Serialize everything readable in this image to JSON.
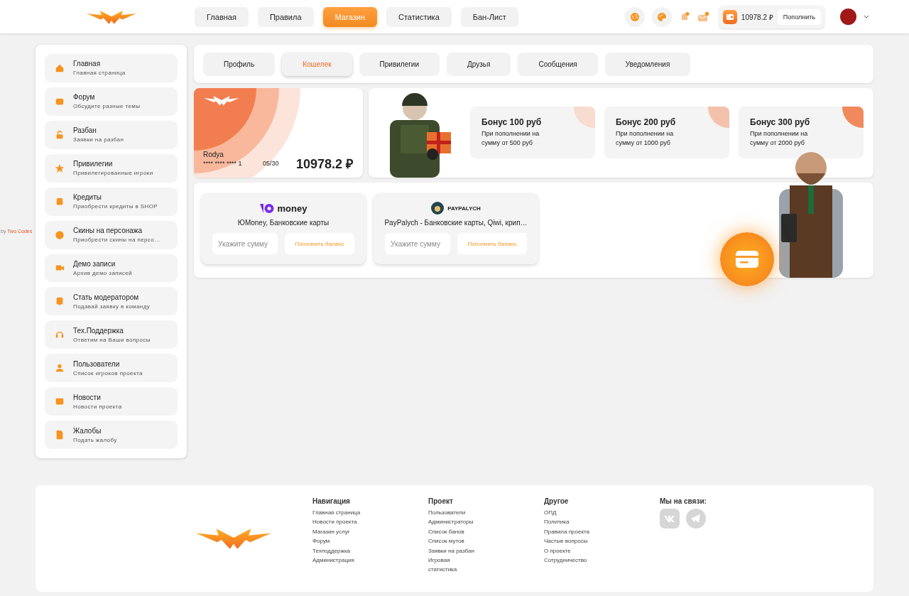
{
  "header": {
    "nav": [
      {
        "label": "Главная",
        "selected": false
      },
      {
        "label": "Правила",
        "selected": false
      },
      {
        "label": "Магазин",
        "selected": true
      },
      {
        "label": "Статистика",
        "selected": false
      },
      {
        "label": "Бан-Лист",
        "selected": false
      }
    ],
    "balance": "10978.2 ₽",
    "topup": "Пополнить",
    "notifications": true,
    "messages": true
  },
  "credit": {
    "prefix": "by",
    "link": "Two Codes"
  },
  "sidebar": {
    "items": [
      {
        "title": "Главная",
        "subtitle": "Главная страница"
      },
      {
        "title": "Форум",
        "subtitle": "Обсудите разные темы"
      },
      {
        "title": "Разбан",
        "subtitle": "Заявки на разбан"
      },
      {
        "title": "Привилегии",
        "subtitle": "Привилегированные игроки"
      },
      {
        "title": "Кредиты",
        "subtitle": "Приобрести кредиты в SHOP"
      },
      {
        "title": "Скины на персонажа",
        "subtitle": "Приобрести скины на персо…"
      },
      {
        "title": "Демо записи",
        "subtitle": "Архив демо записей"
      },
      {
        "title": "Стать модератором",
        "subtitle": "Подавай заявку в команду"
      },
      {
        "title": "Тех.Поддержка",
        "subtitle": "Ответим на Ваши вопросы"
      },
      {
        "title": "Пользователи",
        "subtitle": "Список игроков проекта"
      },
      {
        "title": "Новости",
        "subtitle": "Новости проекта"
      },
      {
        "title": "Жалобы",
        "subtitle": "Подать жалобу"
      }
    ]
  },
  "tabs": [
    {
      "label": "Профиль",
      "selected": false
    },
    {
      "label": "Кошелек",
      "selected": true
    },
    {
      "label": "Привилегии",
      "selected": false
    },
    {
      "label": "Друзья",
      "selected": false
    },
    {
      "label": "Сообщения",
      "selected": false
    },
    {
      "label": "Уведомления",
      "selected": false
    }
  ],
  "wallet_card": {
    "name": "Rodya",
    "number": "**** **** **** 1",
    "expiry": "05/30",
    "balance": "10978.2 ₽"
  },
  "bonuses": [
    {
      "title": "Бонус 100 руб",
      "text": "При пополнении на сумму от 500 руб",
      "color": "#f7dccf"
    },
    {
      "title": "Бонус 200 руб",
      "text": "При пополнении на сумму от 1000 руб",
      "color": "#f4c2ab"
    },
    {
      "title": "Бонус 300 руб",
      "text": "При пополнении на сумму от 2000 руб",
      "color": "#f08a5d"
    }
  ],
  "payments": [
    {
      "kind": "yoomoney",
      "logo": "money",
      "description": "ЮMoney, Банковские карты",
      "placeholder": "Укажите сумму",
      "button": "Пополнить баланс"
    },
    {
      "kind": "paypalych",
      "logo": "PAYPALYCH",
      "description": "PayPalych - Банковские карты, Qiwi, крип…",
      "placeholder": "Укажите сумму",
      "button": "Пополнить баланс"
    }
  ],
  "footer": {
    "columns": [
      {
        "title": "Навигация",
        "links": [
          "Главная страница",
          "Новости проекта",
          "Магазин услуг",
          "Форум",
          "Техподдержка",
          "Администрация"
        ]
      },
      {
        "title": "Проект",
        "links": [
          "Пользователи",
          "Администраторы",
          "Список банов",
          "Список мутов",
          "Заявки на разбан",
          "Игровая статистика"
        ]
      },
      {
        "title": "Другое",
        "links": [
          "ОПД",
          "Политика",
          "Правила проекта",
          "Частые вопросы",
          "О проекте",
          "Сотрудничество"
        ]
      }
    ],
    "contact_title": "Мы на связи:"
  }
}
